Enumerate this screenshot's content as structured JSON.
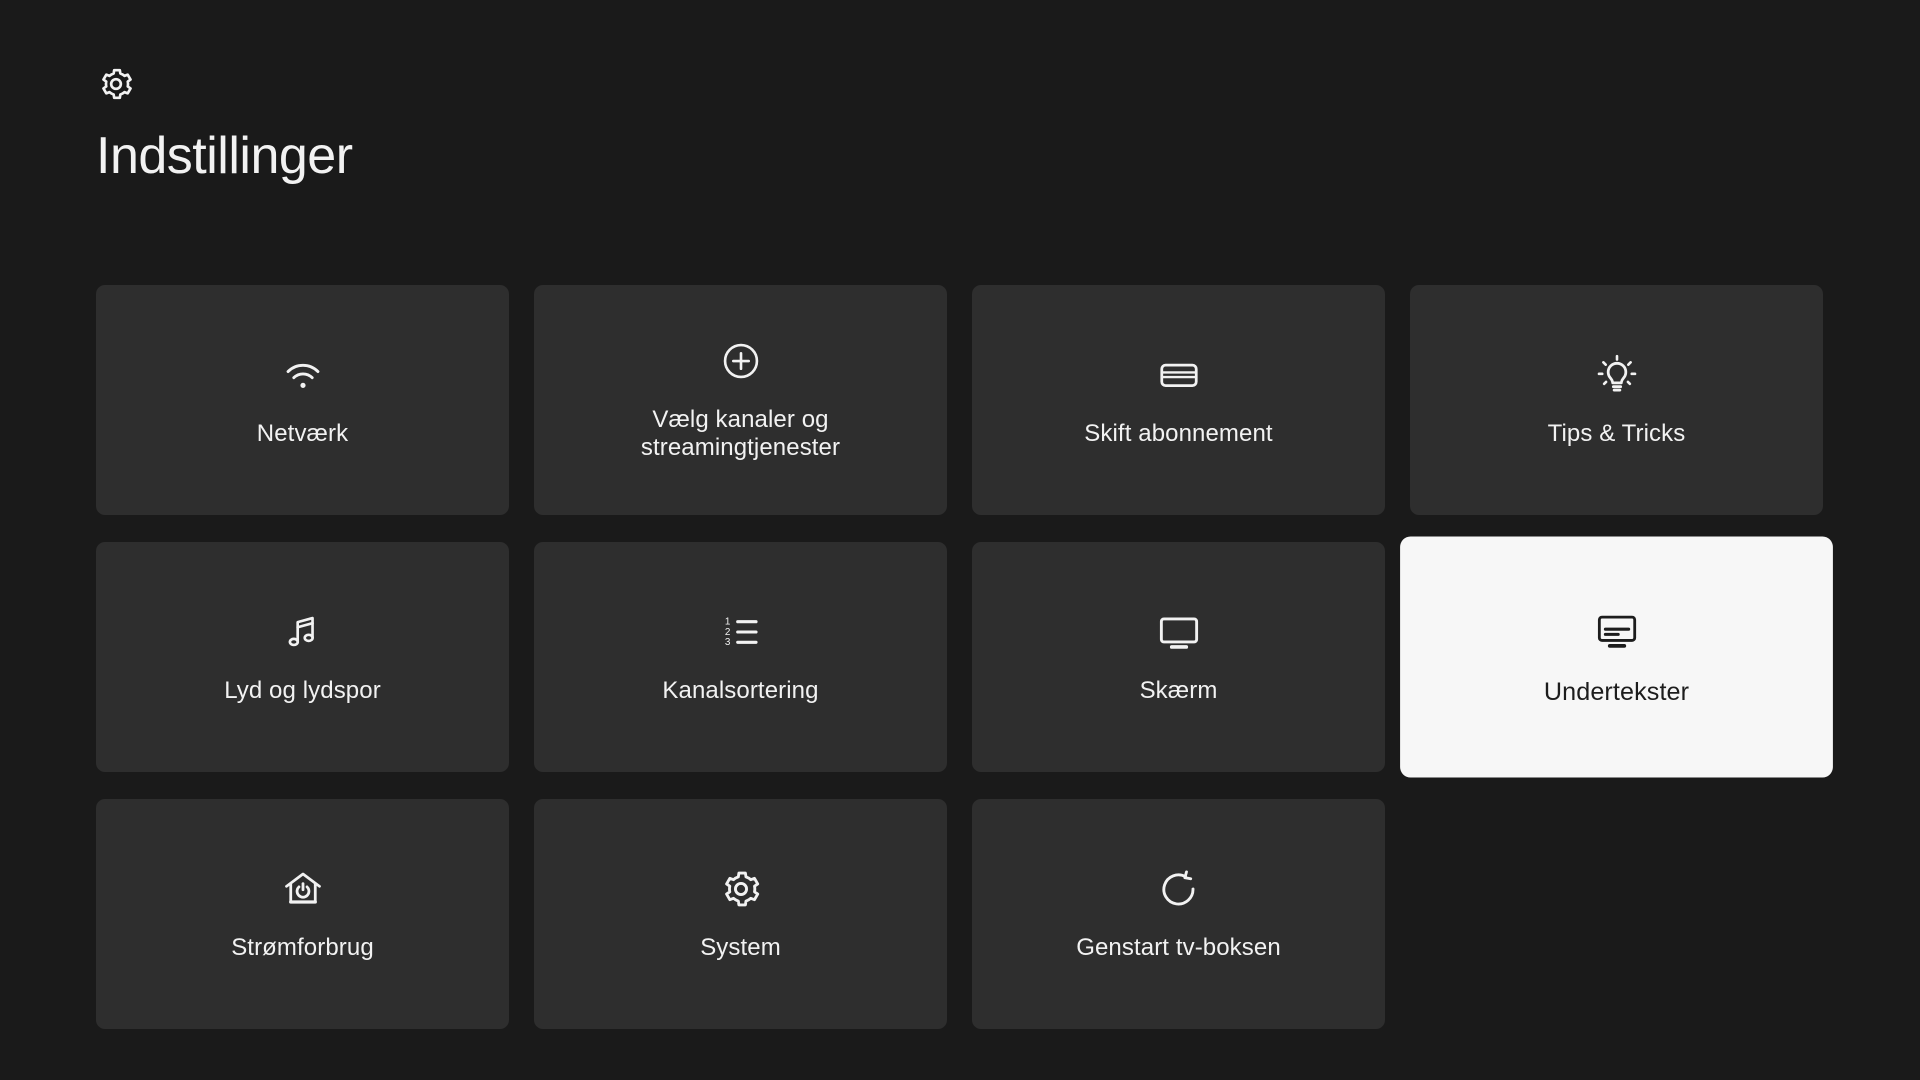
{
  "screen": {
    "background_color": "#1a1a1a",
    "tile_color": "#2e2e2e",
    "selected_tile_color": "#f7f7f7",
    "text_color": "#f2f2f2",
    "selected_text_color": "#1d1d1d"
  },
  "header": {
    "icon": "gear-icon",
    "title": "Indstillinger"
  },
  "grid": {
    "columns": 4,
    "rows": 3,
    "tiles": [
      {
        "id": "netvaerk",
        "label": "Netværk",
        "icon": "wifi-icon",
        "selected": false
      },
      {
        "id": "vaelg-kanaler",
        "label": "Vælg kanaler og streamingtjenester",
        "icon": "plus-circle-icon",
        "selected": false
      },
      {
        "id": "skift-abonnement",
        "label": "Skift abonnement",
        "icon": "credit-card-icon",
        "selected": false
      },
      {
        "id": "tips-tricks",
        "label": "Tips & Tricks",
        "icon": "lightbulb-icon",
        "selected": false
      },
      {
        "id": "lyd-og-lydspor",
        "label": "Lyd og lydspor",
        "icon": "music-note-icon",
        "selected": false
      },
      {
        "id": "kanalsortering",
        "label": "Kanalsortering",
        "icon": "numbered-list-icon",
        "selected": false
      },
      {
        "id": "skaerm",
        "label": "Skærm",
        "icon": "monitor-icon",
        "selected": false
      },
      {
        "id": "undertekster",
        "label": "Undertekster",
        "icon": "subtitles-icon",
        "selected": true
      },
      {
        "id": "stroemforbrug",
        "label": "Strømforbrug",
        "icon": "house-power-icon",
        "selected": false
      },
      {
        "id": "system",
        "label": "System",
        "icon": "gear-icon",
        "selected": false
      },
      {
        "id": "genstart-tv-boksen",
        "label": "Genstart tv-boksen",
        "icon": "restart-icon",
        "selected": false
      }
    ]
  }
}
